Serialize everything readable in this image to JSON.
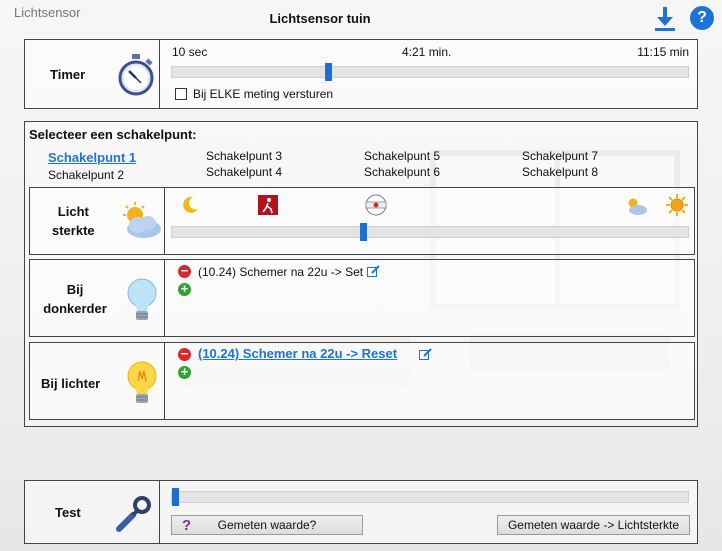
{
  "window_title": "Lichtsensor",
  "page_title": "Lichtsensor tuin",
  "timer": {
    "label": "Timer",
    "min_label": "10 sec",
    "mid_label": "4:21 min.",
    "max_label": "11:15 min",
    "slider_value": 0.3,
    "checkbox_label": "Bij ELKE meting versturen",
    "checkbox_checked": false
  },
  "schakelpunten": {
    "heading": "Selecteer een schakelpunt:",
    "items": [
      "Schakelpunt 1",
      "Schakelpunt 2",
      "Schakelpunt 3",
      "Schakelpunt 4",
      "Schakelpunt 5",
      "Schakelpunt 6",
      "Schakelpunt 7",
      "Schakelpunt 8"
    ],
    "selected": "Schakelpunt 1"
  },
  "lichtsterkte": {
    "label_line1": "Licht",
    "label_line2": "sterkte",
    "slider_value": 0.37,
    "scale_icons": [
      "moon-icon",
      "exit-sign-icon",
      "lux-meter-icon",
      "cloud-sun-icon",
      "sun-icon"
    ]
  },
  "bij_donkerder": {
    "label_line1": "Bij",
    "label_line2": "donkerder",
    "action_text": "(10.24) Schemer na 22u -> Set"
  },
  "bij_lichter": {
    "label": "Bij lichter",
    "action_text": "(10.24) Schemer na 22u -> Reset"
  },
  "test": {
    "label": "Test",
    "slider_value": 0.0,
    "measure_button": "Gemeten waarde?",
    "measure_icon": "?",
    "apply_button": "Gemeten waarde -> Lichtsterkte"
  },
  "colors": {
    "accent": "#1e73d6",
    "remove": "#d62929",
    "add": "#2ea52e"
  }
}
